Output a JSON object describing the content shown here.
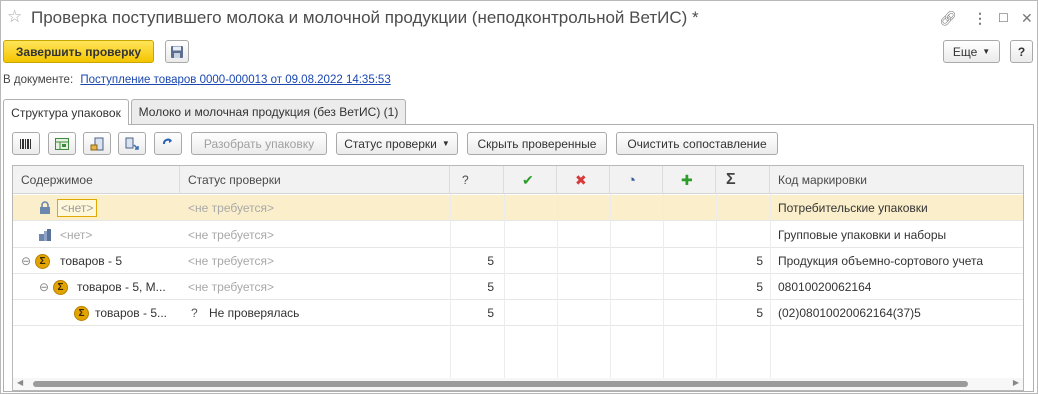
{
  "window": {
    "title": "Проверка поступившего молока и молочной продукции (неподконтрольной ВетИС) *",
    "link_icon": "link-icon",
    "menu_icon": "kebab-menu-icon",
    "maximize_icon": "maximize-icon",
    "close_icon": "close-icon"
  },
  "toolbar": {
    "finish_label": "Завершить проверку",
    "save_icon": "floppy-disk-icon",
    "more_label": "Еще",
    "help_label": "?"
  },
  "document": {
    "prefix": "В документе:",
    "link": "Поступление товаров 0000-000013 от 09.08.2022 14:35:53"
  },
  "tabs": [
    {
      "label": "Структура упаковок",
      "active": true
    },
    {
      "label": "Молоко и молочная продукция (без ВетИС) (1)",
      "active": false
    }
  ],
  "inner_toolbar": {
    "icons": [
      "barcode-scan-icon",
      "table-select-icon",
      "add-package-icon",
      "unpack-icon",
      "refresh-icon"
    ],
    "unpack_label": "Разобрать упаковку",
    "status_label": "Статус проверки",
    "hide_checked_label": "Скрыть проверенные",
    "clear_match_label": "Очистить сопоставление"
  },
  "grid": {
    "headers": {
      "content": "Содержимое",
      "status": "Статус проверки",
      "unknown": "?",
      "ok_icon": "✔",
      "bad_icon": "✖",
      "partial_icon": "◔",
      "plus_icon": "✚",
      "sum_icon": "Σ",
      "code": "Код маркировки"
    },
    "rows": [
      {
        "content": "<нет>",
        "status": "<не требуется>",
        "q": "",
        "total": "",
        "code": "Потребительские упаковки"
      },
      {
        "content": "<нет>",
        "status": "<не требуется>",
        "q": "",
        "total": "",
        "code": "Групповые упаковки и наборы"
      },
      {
        "content": "товаров - 5",
        "status": "<не требуется>",
        "q": "5",
        "total": "5",
        "code": "Продукция объемно-сортового учета"
      },
      {
        "content": "товаров - 5, М...",
        "status": "<не требуется>",
        "q": "5",
        "total": "5",
        "code": "08010020062164"
      },
      {
        "content": "товаров - 5...",
        "status_mark": "?",
        "status": "Не проверялась",
        "q": "5",
        "total": "5",
        "code": "(02)08010020062164(37)5"
      }
    ],
    "sigma": "Σ",
    "toggle": "⊖"
  },
  "colors": {
    "primary": "#f4c500",
    "selected_row": "#fbefcb",
    "link": "#1a47b0",
    "check_green": "#2a9d2a",
    "cross_red": "#d63a3a"
  }
}
